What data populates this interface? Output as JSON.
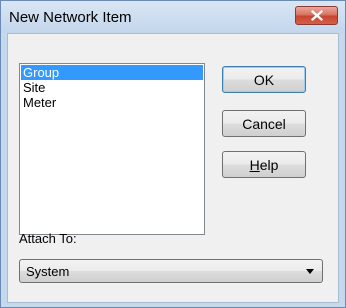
{
  "window": {
    "title": "New Network Item",
    "close_icon": "close-x-icon"
  },
  "list": {
    "items": [
      "Group",
      "Site",
      "Meter"
    ],
    "selected": "Group"
  },
  "buttons": {
    "ok_label": "OK",
    "cancel_label": "Cancel",
    "help_mnemonic": "H",
    "help_rest": "elp"
  },
  "attach": {
    "label": "Attach To:",
    "selected_value": "System",
    "arrow_icon": "dropdown-arrow-icon"
  },
  "colors": {
    "selection": "#3399ff",
    "titlebar": "#c6d8ec",
    "close_button": "#c7442f"
  }
}
